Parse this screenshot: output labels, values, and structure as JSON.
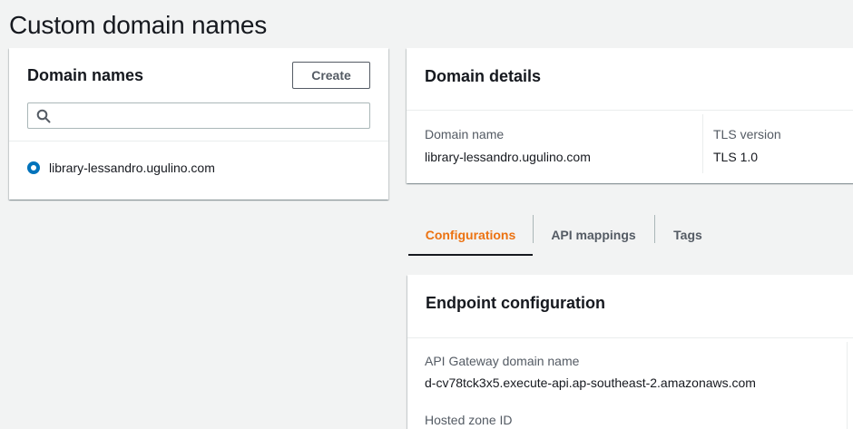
{
  "page": {
    "title": "Custom domain names"
  },
  "domain_list": {
    "heading": "Domain names",
    "create_label": "Create",
    "search": {
      "placeholder": "",
      "value": ""
    },
    "items": [
      {
        "label": "library-lessandro.ugulino.com",
        "selected": true
      }
    ]
  },
  "details": {
    "heading": "Domain details",
    "domain_name_label": "Domain name",
    "domain_name_value": "library-lessandro.ugulino.com",
    "tls_label": "TLS version",
    "tls_value": "TLS 1.0"
  },
  "tabs": [
    {
      "label": "Configurations",
      "active": true
    },
    {
      "label": "API mappings",
      "active": false
    },
    {
      "label": "Tags",
      "active": false
    }
  ],
  "endpoint": {
    "heading": "Endpoint configuration",
    "api_gateway_label": "API Gateway domain name",
    "api_gateway_value": "d-cv78tck3x5.execute-api.ap-southeast-2.amazonaws.com",
    "hosted_zone_label": "Hosted zone ID"
  },
  "colors": {
    "accent": "#ec7211",
    "radio": "#0073bb",
    "background": "#f2f3f3",
    "text": "#16191f"
  }
}
